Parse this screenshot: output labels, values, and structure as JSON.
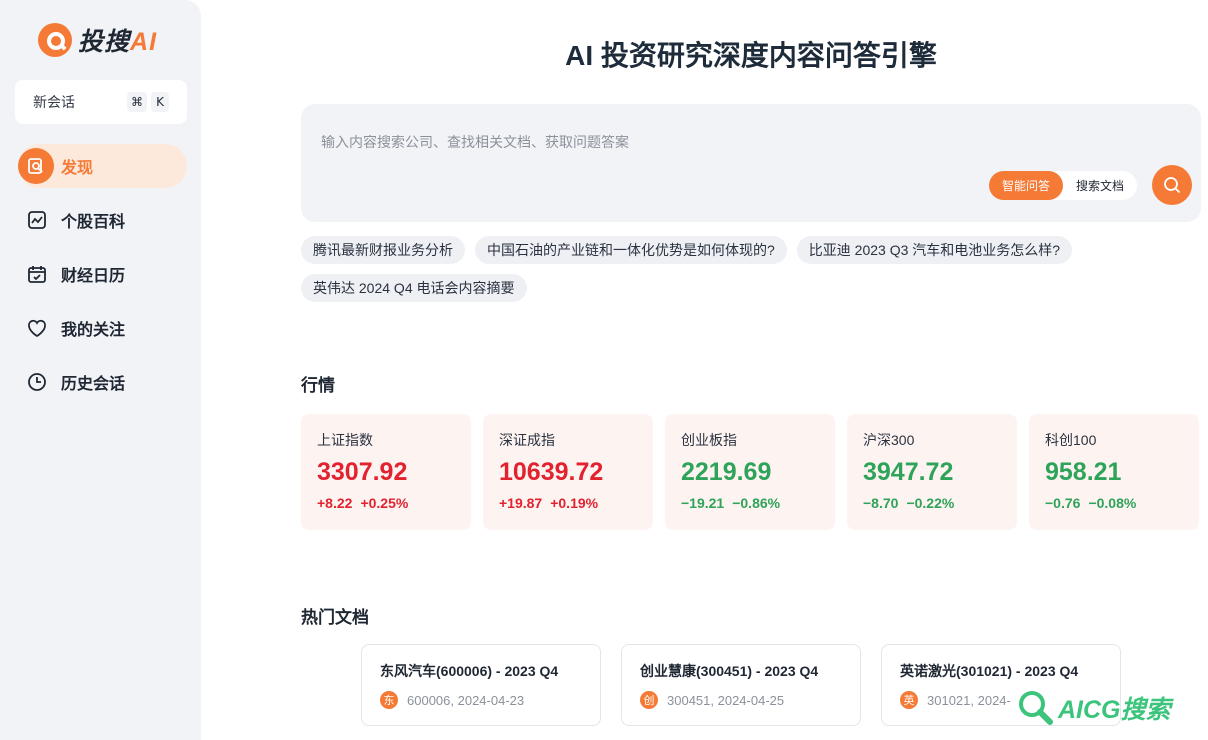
{
  "brand": {
    "name": "投搜",
    "ai": "AI"
  },
  "sidebar": {
    "new_chat": {
      "label": "新会话",
      "shortcut": [
        "⌘",
        "K"
      ]
    },
    "items": [
      {
        "label": "发现",
        "icon": "discover-icon",
        "active": true
      },
      {
        "label": "个股百科",
        "icon": "chart-trend-icon",
        "active": false
      },
      {
        "label": "财经日历",
        "icon": "calendar-icon",
        "active": false
      },
      {
        "label": "我的关注",
        "icon": "heart-icon",
        "active": false
      },
      {
        "label": "历史会话",
        "icon": "clock-icon",
        "active": false
      }
    ]
  },
  "main": {
    "title": "AI 投资研究深度内容问答引擎",
    "search": {
      "placeholder": "输入内容搜索公司、查找相关文档、获取问题答案",
      "value": "",
      "modes": [
        {
          "label": "智能问答",
          "active": true
        },
        {
          "label": "搜索文档",
          "active": false
        }
      ]
    },
    "suggestions": [
      "腾讯最新财报业务分析",
      "中国石油的产业链和一体化优势是如何体现的?",
      "比亚迪 2023 Q3 汽车和电池业务怎么样?",
      "英伟达 2024 Q4 电话会内容摘要"
    ],
    "market_title": "行情",
    "market": [
      {
        "name": "上证指数",
        "value": "3307.92",
        "change": "+8.22",
        "pct": "+0.25%",
        "trend": "up"
      },
      {
        "name": "深证成指",
        "value": "10639.72",
        "change": "+19.87",
        "pct": "+0.19%",
        "trend": "up"
      },
      {
        "name": "创业板指",
        "value": "2219.69",
        "change": "−19.21",
        "pct": "−0.86%",
        "trend": "down"
      },
      {
        "name": "沪深300",
        "value": "3947.72",
        "change": "−8.70",
        "pct": "−0.22%",
        "trend": "down"
      },
      {
        "name": "科创100",
        "value": "958.21",
        "change": "−0.76",
        "pct": "−0.08%",
        "trend": "down"
      }
    ],
    "docs_title": "热门文档",
    "docs": [
      {
        "title": "东风汽车(600006) - 2023 Q4",
        "badge": "东",
        "meta": "600006, 2024-04-23"
      },
      {
        "title": "创业慧康(300451) - 2023 Q4",
        "badge": "创",
        "meta": "300451, 2024-04-25"
      },
      {
        "title": "英诺激光(301021) - 2023 Q4",
        "badge": "英",
        "meta": "301021, 2024-"
      }
    ]
  },
  "watermark": "AICG搜索",
  "colors": {
    "accent": "#f47a35",
    "up": "#e2222f",
    "down": "#2ea35a",
    "sidebar_bg": "#f2f3f7"
  }
}
